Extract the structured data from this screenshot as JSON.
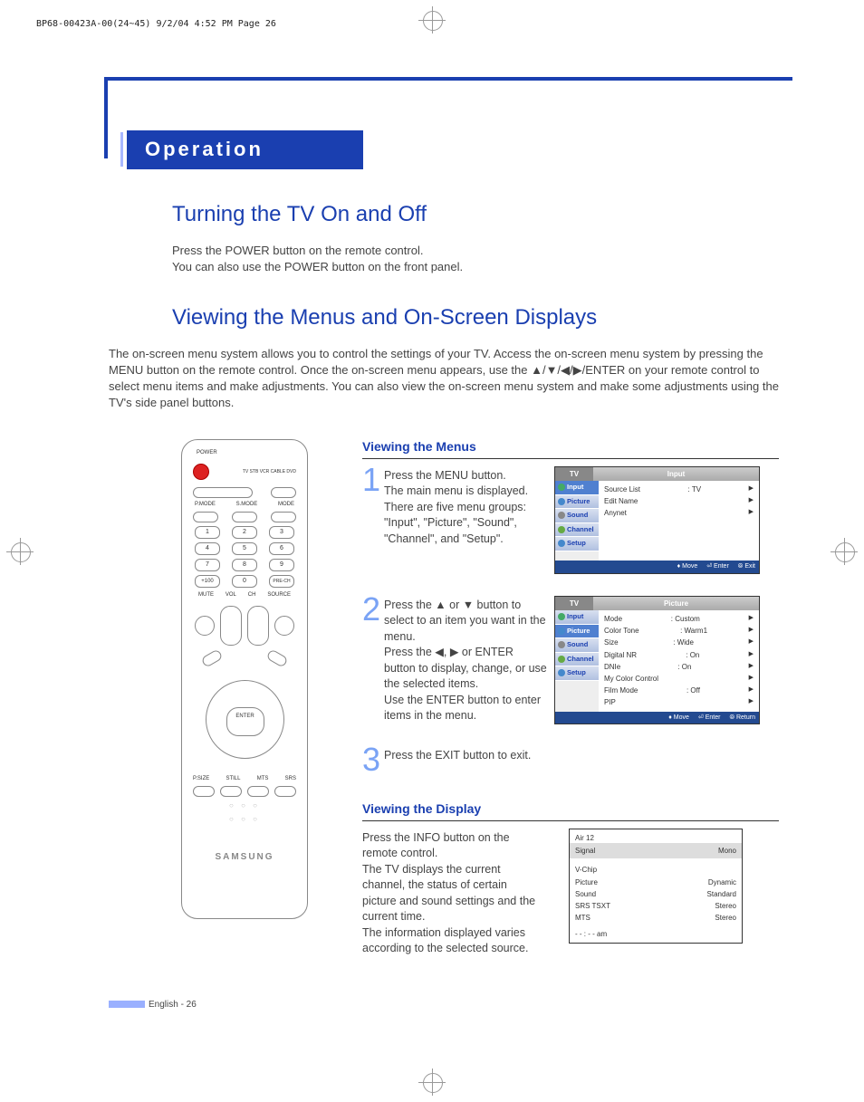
{
  "header": "BP68-00423A-00(24~45)  9/2/04  4:52 PM  Page 26",
  "section": "Operation",
  "h1": "Turning the TV On and Off",
  "p1": "Press the POWER button on the remote control.\nYou can also use the POWER button on the front panel.",
  "h2": "Viewing the Menus and On-Screen Displays",
  "p2": "The on-screen menu system allows you to control the settings of your TV. Access the on-screen menu system by pressing the MENU button on the remote control. Once the on-screen menu appears, use the ▲/▼/◀/▶/ENTER on your remote control to select menu items and make adjustments. You can also view the on-screen menu system and make some adjustments using the TV's side panel buttons.",
  "sub1": "Viewing the Menus",
  "step1": {
    "num": "1",
    "text": "Press the MENU button.\nThe main menu is displayed. There are five menu groups: \"Input\", \"Picture\", \"Sound\", \"Channel\", and \"Setup\"."
  },
  "step2": {
    "num": "2",
    "text": "Press the ▲ or ▼ button to select to an item you want in the menu.\nPress the ◀, ▶ or ENTER button to display, change, or use the selected items.\nUse the ENTER button to enter items in the menu."
  },
  "step3": {
    "num": "3",
    "text": "Press the EXIT button to exit."
  },
  "sub2": "Viewing the Display",
  "display_text": "Press the INFO button on the remote control.\nThe TV displays the current channel, the status of certain picture and sound settings and the current time.\nThe information displayed varies according to the selected source.",
  "remote": {
    "brand": "SAMSUNG",
    "enter": "ENTER",
    "power": "POWER",
    "modes": "TV  STB  VCR  CABLE  DVD",
    "toprow": [
      "P.MODE",
      "S.MODE",
      "MODE"
    ],
    "nums": [
      [
        "1",
        "2",
        "3"
      ],
      [
        "4",
        "5",
        "6"
      ],
      [
        "7",
        "8",
        "9"
      ],
      [
        "+100",
        "0",
        "PRE-CH"
      ]
    ],
    "vol": "VOL",
    "ch": "CH",
    "mute": "MUTE",
    "source": "SOURCE",
    "botrow": [
      "P.SIZE",
      "STILL",
      "MTS",
      "SRS"
    ]
  },
  "osd1": {
    "tab": "TV",
    "title": "Input",
    "side": [
      "Input",
      "Picture",
      "Sound",
      "Channel",
      "Setup"
    ],
    "rows": [
      [
        "Source List",
        ": TV"
      ],
      [
        "Edit Name",
        ""
      ],
      [
        "Anynet",
        ""
      ]
    ],
    "footer": [
      "Move",
      "Enter",
      "Exit"
    ]
  },
  "osd2": {
    "tab": "TV",
    "title": "Picture",
    "side": [
      "Input",
      "Picture",
      "Sound",
      "Channel",
      "Setup"
    ],
    "rows": [
      [
        "Mode",
        ": Custom"
      ],
      [
        "Color Tone",
        ": Warm1"
      ],
      [
        "Size",
        ": Wide"
      ],
      [
        "Digital NR",
        ": On"
      ],
      [
        "DNIe",
        ": On"
      ],
      [
        "My Color Control",
        ""
      ],
      [
        "Film Mode",
        ": Off"
      ],
      [
        "PIP",
        ""
      ]
    ],
    "footer": [
      "Move",
      "Enter",
      "Return"
    ]
  },
  "info": {
    "air": "Air  12",
    "signal": "Signal",
    "mono": "Mono",
    "rows": [
      [
        "V-Chip",
        ""
      ],
      [
        "Picture",
        "Dynamic"
      ],
      [
        "Sound",
        "Standard"
      ],
      [
        "SRS TSXT",
        "Stereo"
      ],
      [
        "MTS",
        "Stereo"
      ]
    ],
    "time": "- - : - -   am"
  },
  "footer": "English - 26"
}
